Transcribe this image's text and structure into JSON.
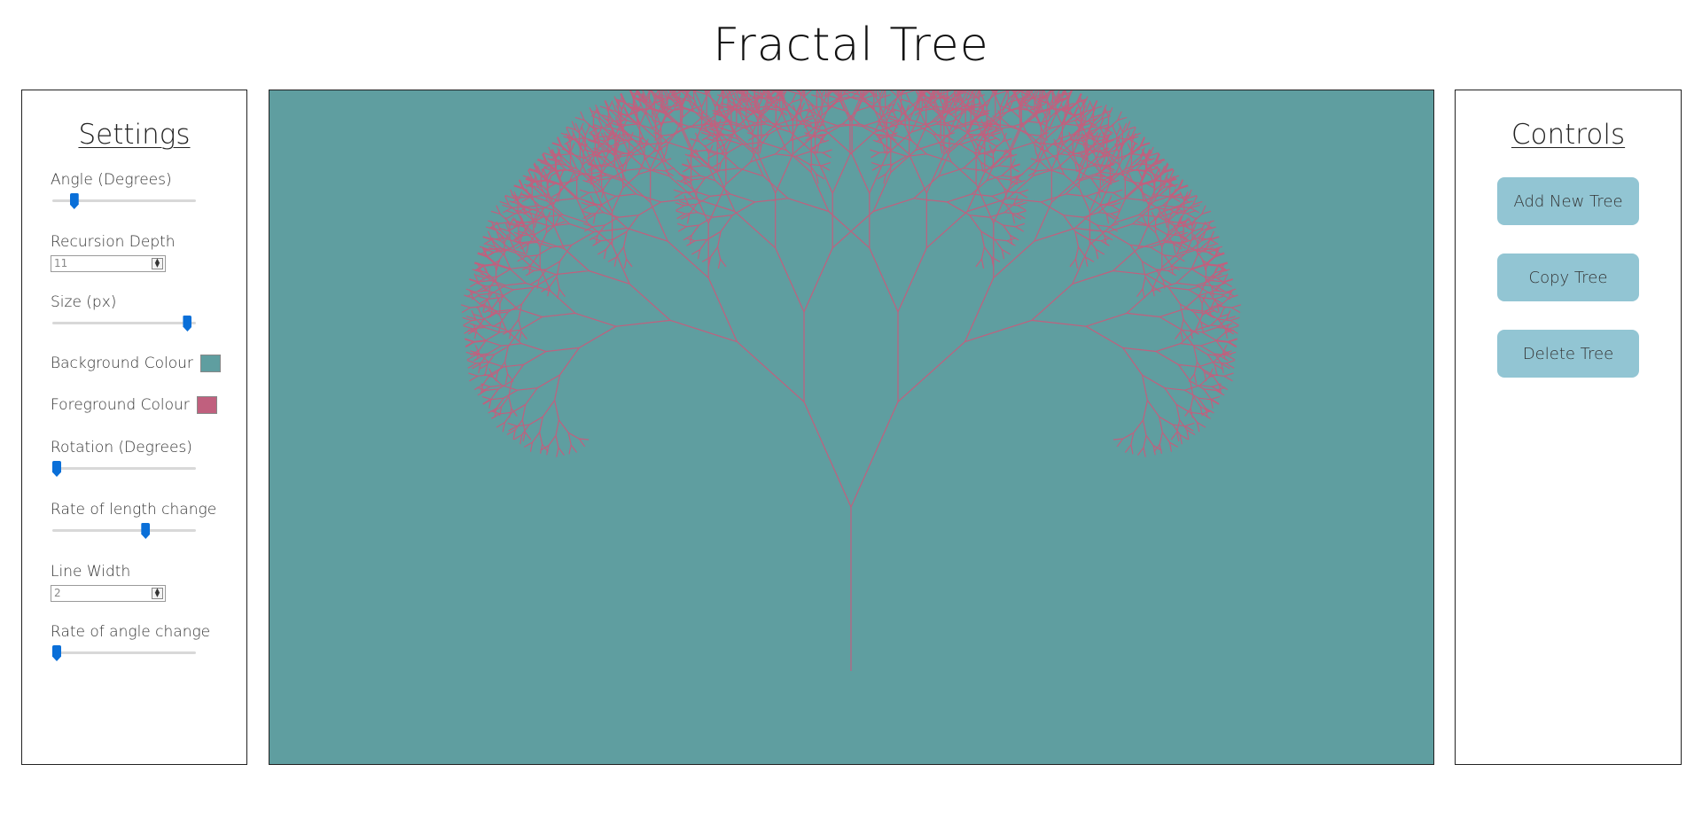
{
  "page": {
    "title": "Fractal Tree"
  },
  "settings": {
    "heading": "Settings",
    "angle": {
      "label": "Angle (Degrees)",
      "value_fraction": 0.13
    },
    "recursion_depth": {
      "label": "Recursion Depth",
      "value": "11"
    },
    "size": {
      "label": "Size (px)",
      "value_fraction": 0.97
    },
    "background_colour": {
      "label": "Background Colour",
      "color": "#5f9ea0"
    },
    "foreground_colour": {
      "label": "Foreground Colour",
      "color": "#c0607e"
    },
    "rotation": {
      "label": "Rotation (Degrees)",
      "value_fraction": 0.0
    },
    "rate_of_length_change": {
      "label": "Rate of length change",
      "value_fraction": 0.66
    },
    "line_width": {
      "label": "Line Width",
      "value": "2"
    },
    "rate_of_angle_change": {
      "label": "Rate of angle change",
      "value_fraction": 0.0
    }
  },
  "controls": {
    "heading": "Controls",
    "buttons": [
      {
        "label": "Add New Tree"
      },
      {
        "label": "Copy Tree"
      },
      {
        "label": "Delete Tree"
      }
    ],
    "button_color": "#92c5d3"
  },
  "icons": {
    "stepper": "spin-arrows-icon"
  }
}
